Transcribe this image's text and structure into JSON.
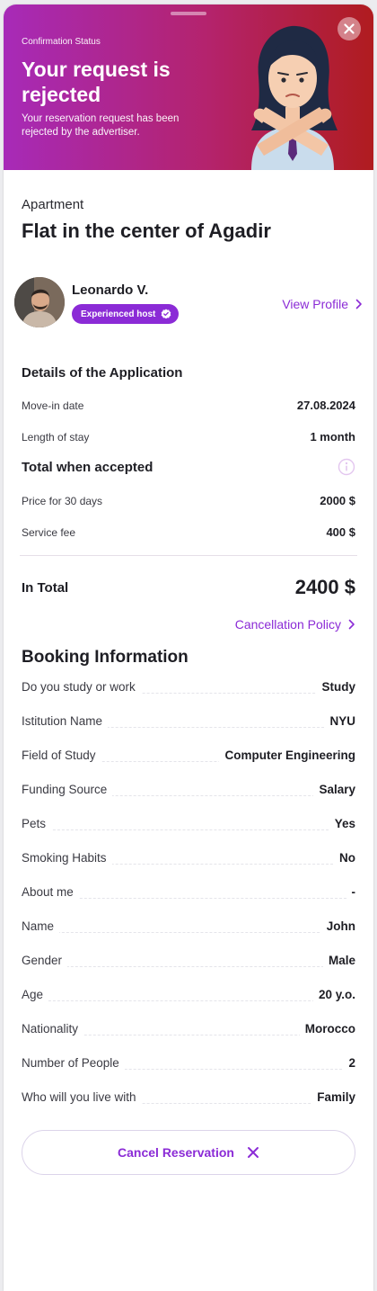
{
  "banner": {
    "status_label": "Confirmation Status",
    "title": "Your request is rejected",
    "text": "Your reservation request has been rejected by the advertiser.",
    "close_icon": "close-icon",
    "illustration_icon": "rejected-person-illustration"
  },
  "listing": {
    "type": "Apartment",
    "title": "Flat in the center of Agadir"
  },
  "host": {
    "name": "Leonardo V.",
    "badge": "Experienced host",
    "view_profile": "View Profile"
  },
  "application": {
    "heading": "Details of the Application",
    "move_in_label": "Move-in date",
    "move_in_value": "27.08.2024",
    "stay_label": "Length of stay",
    "stay_value": "1 month"
  },
  "totals": {
    "heading": "Total when accepted",
    "price_label": "Price for 30 days",
    "price_value": "2000 $",
    "fee_label": "Service fee",
    "fee_value": "400 $",
    "total_label": "In Total",
    "total_value": "2400 $",
    "cancellation_policy": "Cancellation Policy"
  },
  "booking": {
    "heading": "Booking Information",
    "rows": [
      {
        "label": "Do you study or work",
        "value": "Study"
      },
      {
        "label": "Istitution Name",
        "value": "NYU"
      },
      {
        "label": "Field of Study",
        "value": "Computer Engineering"
      },
      {
        "label": "Funding Source",
        "value": "Salary"
      },
      {
        "label": "Pets",
        "value": "Yes"
      },
      {
        "label": "Smoking Habits",
        "value": "No"
      },
      {
        "label": "About me",
        "value": "-"
      },
      {
        "label": "Name",
        "value": "John"
      },
      {
        "label": "Gender",
        "value": "Male"
      },
      {
        "label": "Age",
        "value": "20 y.o."
      },
      {
        "label": "Nationality",
        "value": "Morocco"
      },
      {
        "label": "Number of People",
        "value": "2"
      },
      {
        "label": "Who will you live with",
        "value": "Family"
      }
    ]
  },
  "actions": {
    "cancel_reservation": "Cancel Reservation"
  },
  "colors": {
    "accent": "#8b2bd6",
    "banner_start": "#a72ab8",
    "banner_end": "#b01c1f"
  }
}
